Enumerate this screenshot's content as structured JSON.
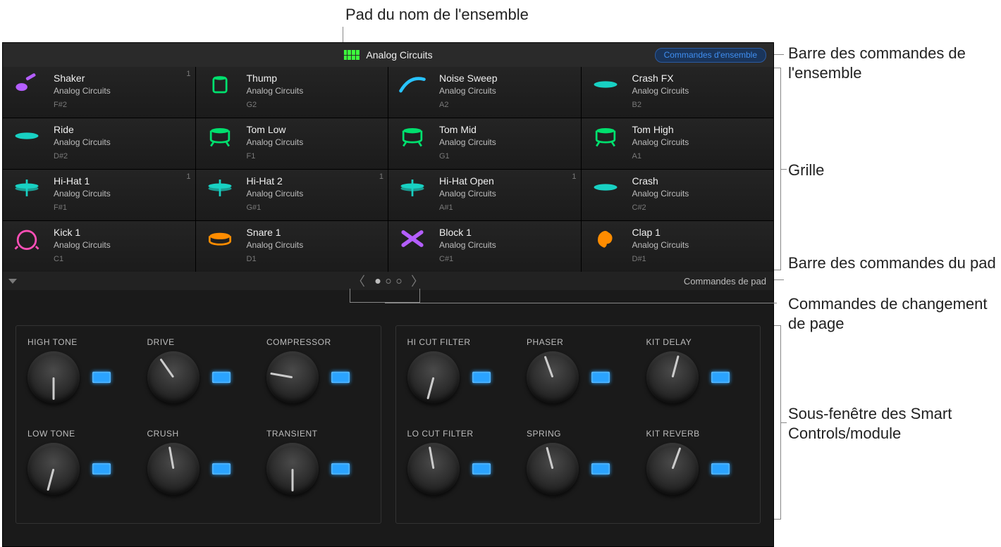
{
  "annotations": {
    "kit_name_pad": "Pad du nom de l'ensemble",
    "kit_bar": "Barre des commandes de l'ensemble",
    "grid": "Grille",
    "pad_bar": "Barre des commandes du pad",
    "page_change": "Commandes de changement de page",
    "smart_pane": "Sous-fenêtre des Smart Controls/module"
  },
  "kit_bar": {
    "kit_name": "Analog Circuits",
    "kit_controls_button": "Commandes d'ensemble"
  },
  "grid": [
    {
      "name": "Shaker",
      "preset": "Analog Circuits",
      "note": "F#2",
      "color": "#b45eff",
      "icon": "shaker",
      "count": "1"
    },
    {
      "name": "Thump",
      "preset": "Analog Circuits",
      "note": "G2",
      "color": "#00e06e",
      "icon": "drum-v",
      "count": ""
    },
    {
      "name": "Noise Sweep",
      "preset": "Analog Circuits",
      "note": "A2",
      "color": "#28c3ff",
      "icon": "sweep",
      "count": ""
    },
    {
      "name": "Crash FX",
      "preset": "Analog Circuits",
      "note": "B2",
      "color": "#18d1c3",
      "icon": "cymbal",
      "count": ""
    },
    {
      "name": "Ride",
      "preset": "Analog Circuits",
      "note": "D#2",
      "color": "#18d1c3",
      "icon": "cymbal",
      "count": ""
    },
    {
      "name": "Tom Low",
      "preset": "Analog Circuits",
      "note": "F1",
      "color": "#00e06e",
      "icon": "tom",
      "count": ""
    },
    {
      "name": "Tom Mid",
      "preset": "Analog Circuits",
      "note": "G1",
      "color": "#00e06e",
      "icon": "tom",
      "count": ""
    },
    {
      "name": "Tom High",
      "preset": "Analog Circuits",
      "note": "A1",
      "color": "#00e06e",
      "icon": "tom",
      "count": ""
    },
    {
      "name": "Hi-Hat 1",
      "preset": "Analog Circuits",
      "note": "F#1",
      "color": "#18d1c3",
      "icon": "hihat",
      "count": "1"
    },
    {
      "name": "Hi-Hat 2",
      "preset": "Analog Circuits",
      "note": "G#1",
      "color": "#18d1c3",
      "icon": "hihat",
      "count": "1"
    },
    {
      "name": "Hi-Hat Open",
      "preset": "Analog Circuits",
      "note": "A#1",
      "color": "#18d1c3",
      "icon": "hihat",
      "count": "1"
    },
    {
      "name": "Crash",
      "preset": "Analog Circuits",
      "note": "C#2",
      "color": "#18d1c3",
      "icon": "cymbal",
      "count": ""
    },
    {
      "name": "Kick 1",
      "preset": "Analog Circuits",
      "note": "C1",
      "color": "#ff4fb7",
      "icon": "kick",
      "count": ""
    },
    {
      "name": "Snare 1",
      "preset": "Analog Circuits",
      "note": "D1",
      "color": "#ff8c00",
      "icon": "snare",
      "count": ""
    },
    {
      "name": "Block 1",
      "preset": "Analog Circuits",
      "note": "C#1",
      "color": "#b45eff",
      "icon": "sticks",
      "count": ""
    },
    {
      "name": "Clap 1",
      "preset": "Analog Circuits",
      "note": "D#1",
      "color": "#ff8c00",
      "icon": "clap",
      "count": ""
    }
  ],
  "pad_bar": {
    "right_label": "Commandes de pad"
  },
  "knob_groups": [
    [
      {
        "label": "HIGH TONE",
        "angle": 0
      },
      {
        "label": "DRIVE",
        "angle": 145
      },
      {
        "label": "COMPRESSOR",
        "angle": 100
      },
      {
        "label": "LOW TONE",
        "angle": 15
      },
      {
        "label": "CRUSH",
        "angle": 170
      },
      {
        "label": "TRANSIENT",
        "angle": 0
      }
    ],
    [
      {
        "label": "HI CUT FILTER",
        "angle": 15
      },
      {
        "label": "PHASER",
        "angle": 160
      },
      {
        "label": "KIT DELAY",
        "angle": 195
      },
      {
        "label": "LO CUT FILTER",
        "angle": 170
      },
      {
        "label": "SPRING",
        "angle": 165
      },
      {
        "label": "KIT REVERB",
        "angle": 200
      }
    ]
  ]
}
